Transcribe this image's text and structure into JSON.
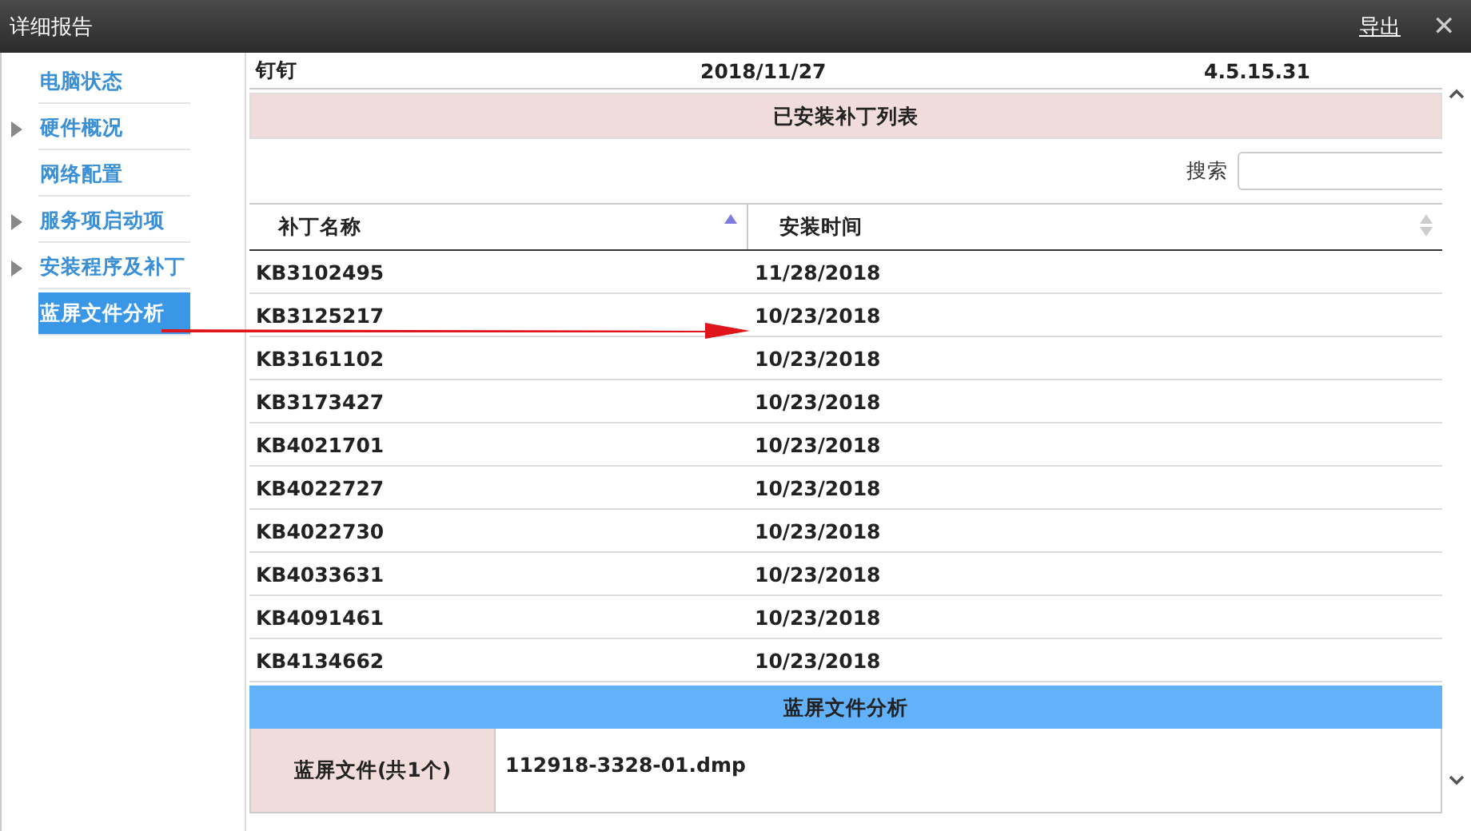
{
  "window": {
    "title": "详细报告",
    "export_link": "导出",
    "close": "✕"
  },
  "sidebar": {
    "items": [
      {
        "label": "电脑状态",
        "expandable": false,
        "selected": false
      },
      {
        "label": "硬件概况",
        "expandable": true,
        "selected": false
      },
      {
        "label": "网络配置",
        "expandable": false,
        "selected": false
      },
      {
        "label": "服务项启动项",
        "expandable": true,
        "selected": false
      },
      {
        "label": "安装程序及补丁",
        "expandable": true,
        "selected": false
      },
      {
        "label": "蓝屏文件分析",
        "expandable": false,
        "selected": true
      }
    ]
  },
  "program_row": [
    "钉钉",
    "2018/11/27",
    "4.5.15.31"
  ],
  "patch_section": {
    "title": "已安装补丁列表",
    "search": {
      "label": "搜索"
    },
    "table": {
      "columns": [
        {
          "label": "补丁名称",
          "sorted_ascending": true
        },
        {
          "label": "安装时间",
          "sorted_ascending": false
        }
      ],
      "rows": [
        [
          "KB3102495",
          "11/28/2018"
        ],
        [
          "KB3125217",
          "10/23/2018"
        ],
        [
          "KB3161102",
          "10/23/2018"
        ],
        [
          "KB3173427",
          "10/23/2018"
        ],
        [
          "KB4021701",
          "10/23/2018"
        ],
        [
          "KB4022727",
          "10/23/2018"
        ],
        [
          "KB4022730",
          "10/23/2018"
        ],
        [
          "KB4033631",
          "10/23/2018"
        ],
        [
          "KB4091461",
          "10/23/2018"
        ],
        [
          "KB4134662",
          "10/23/2018"
        ]
      ]
    }
  },
  "bluescreen_section": {
    "title": "蓝屏文件分析",
    "label": "蓝屏文件(共1个)",
    "file": "112918-3328-01.dmp"
  }
}
